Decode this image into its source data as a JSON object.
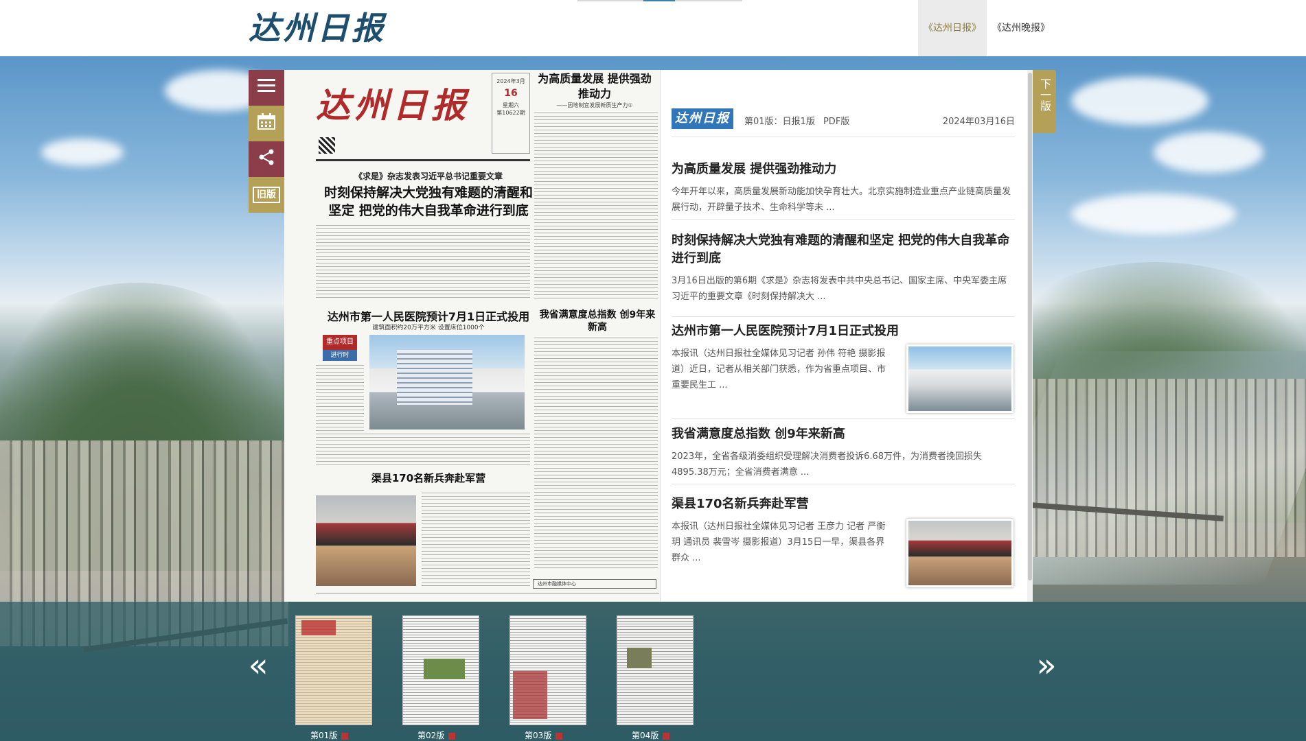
{
  "header": {
    "logo_text": "达州日报",
    "tabs": [
      {
        "label": "《达州日报》",
        "active": true
      },
      {
        "label": "《达州晚报》",
        "active": false
      }
    ]
  },
  "side_tools": {
    "menu_icon": "menu-icon",
    "calendar_icon": "calendar-icon",
    "share_icon": "share-icon",
    "old_label": "旧版"
  },
  "newspaper_page": {
    "masthead": "达州日报",
    "date_box": {
      "top": "2024年3月",
      "day": "16",
      "weekday": "星期六",
      "issue": "第10622期"
    },
    "kicker": "《求是》杂志发表习近平总书记重要文章",
    "headline_1": "时刻保持解决大党独有难题的清醒和坚定 把党的伟大自我革命进行到底",
    "side_headline": "为高质量发展 提供强劲推动力",
    "side_sub": "——因地制宜发展新质生产力①",
    "headline_2": "达州市第一人民医院预计7月1日正式投用",
    "headline_2_sub": "建筑面积约20万平方米 设置床位1000个",
    "tag_1": "重点项目",
    "tag_2": "进行时",
    "headline_3": "我省满意度总指数 创9年来新高",
    "headline_4": "渠县170名新兵奔赴军营",
    "footer_box": "达州市融媒体中心"
  },
  "list": {
    "mini_logo": "达州日报",
    "edition": "第01版：日报1版",
    "pdf_label": "PDF版",
    "date": "2024年03月16日",
    "articles": [
      {
        "title": "为高质量发展 提供强劲推动力",
        "summary": "今年开年以来，高质量发展新动能加快孕育壮大。北京实施制造业重点产业链高质量发展行动，开辟量子技术、生命科学等未 ..."
      },
      {
        "title": "时刻保持解决大党独有难题的清醒和坚定 把党的伟大自我革命进行到底",
        "summary": "3月16日出版的第6期《求是》杂志将发表中共中央总书记、国家主席、中央军委主席习近平的重要文章《时刻保持解决大 ..."
      },
      {
        "title": "达州市第一人民医院预计7月1日正式投用",
        "summary": "本报讯（达州日报社全媒体见习记者 孙伟 符艳 摄影报道）近日，记者从相关部门获悉，作为省重点项目、市重要民生工 ..."
      },
      {
        "title": "我省满意度总指数 创9年来新高",
        "summary": "2023年，全省各级消委组织受理解决消费者投诉6.68万件，为消费者挽回损失4895.38万元；全省消费者满意 ..."
      },
      {
        "title": "渠县170名新兵奔赴军营",
        "summary": "本报讯（达州日报社全媒体见习记者 王彦力 记者 严衡玥 通讯员 裴雪岑 摄影报道）3月15日一早，渠县各界群众 ..."
      }
    ]
  },
  "next_button": "下一版",
  "thumbnails": [
    {
      "label": "第01版"
    },
    {
      "label": "第02版"
    },
    {
      "label": "第03版"
    },
    {
      "label": "第04版"
    }
  ],
  "arrows": {
    "prev": "«",
    "next": "»"
  }
}
